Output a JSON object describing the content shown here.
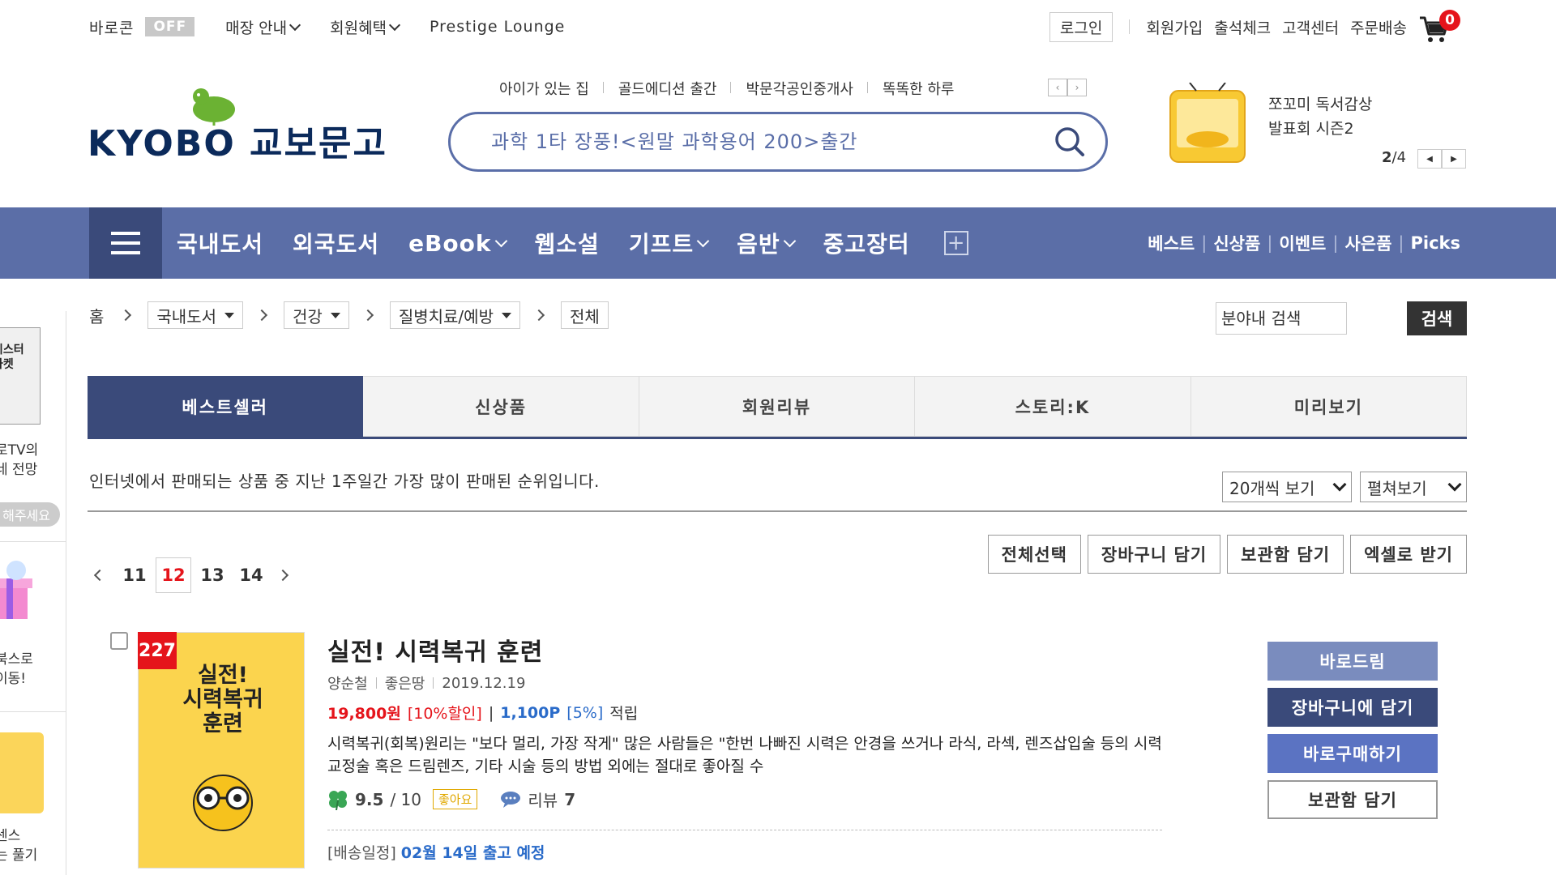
{
  "util": {
    "baro_label": "바로콘",
    "baro_state": "OFF",
    "store_info": "매장 안내",
    "member_benefit": "회원혜택",
    "prestige": "Prestige Lounge",
    "login": "로그인",
    "signup": "회원가입",
    "attendance": "출석체크",
    "support": "고객센터",
    "delivery": "주문배송",
    "cart_count": "0"
  },
  "logo": {
    "text": "KYOBO 교보문고"
  },
  "keywords": [
    "아이가 있는 집",
    "골드에디션 출간",
    "박문각공인중개사",
    "똑똑한 하루"
  ],
  "search": {
    "placeholder": "과학 1타 장풍!<원말 과학용어 200>출간"
  },
  "promo": {
    "line1": "쪼꼬미 독서감상",
    "line2": "발표회 시즌2",
    "page_current": "2",
    "page_total": "/4"
  },
  "nav": {
    "items": [
      "국내도서",
      "외국도서",
      "eBook",
      "웹소설",
      "기프트",
      "음반",
      "중고장터"
    ],
    "right": [
      "베스트",
      "신상품",
      "이벤트",
      "사은품",
      "Picks"
    ]
  },
  "side": {
    "img1_text": "미스터\n마켓",
    "text1": "로TV의\n네 전망",
    "pill": "해주세요",
    "text2": "북스로\n이동!",
    "text3": "센스\n는 풀기"
  },
  "breadcrumb": {
    "home": "홈",
    "level1": "국내도서",
    "level2": "건강",
    "level3": "질병치료/예방",
    "level4": "전체"
  },
  "cat_search": {
    "placeholder": "분야내 검색",
    "button": "검색"
  },
  "tabs": [
    "베스트셀러",
    "신상품",
    "회원리뷰",
    "스토리:K",
    "미리보기"
  ],
  "info": {
    "text": "인터넷에서 판매되는 상품 중 지난 1주일간 가장 많이 판매된 순위입니다.",
    "count_option": "20개씩 보기",
    "view_option": "펼쳐보기"
  },
  "pager": {
    "pages": [
      "11",
      "12",
      "13",
      "14"
    ],
    "current": "12"
  },
  "actions": [
    "전체선택",
    "장바구니 담기",
    "보관함 담기",
    "엑셀로 받기"
  ],
  "product": {
    "rank": "227",
    "cover_title": "실전!\n시력복귀\n훈련",
    "title": "실전! 시력복귀 훈련",
    "author": "양순철",
    "publisher": "좋은땅",
    "date": "2019.12.19",
    "price": "19,800원",
    "discount": "[10%할인]",
    "point": "1,100P",
    "point_rate": "[5%]",
    "point_label": "적립",
    "desc": "시력복귀(회복)원리는 \"보다 멀리, 가장 작게\" 많은 사람들은 \"한번 나빠진 시력은 안경을 쓰거나 라식, 라섹, 렌즈삽입술 등의 시력교정술 혹은 드림렌즈, 기타 시술 등의 방법 외에는 절대로 좋아질 수",
    "rating": "9.5",
    "rating_max": "/ 10",
    "good": "좋아요",
    "review_label": "리뷰",
    "review_count": "7",
    "ship_label": "[배송일정]",
    "ship_date": "02월 14일 출고 예정",
    "btn_baro": "바로드림",
    "btn_cart": "장바구니에 담기",
    "btn_buy": "바로구매하기",
    "btn_keep": "보관함 담기"
  },
  "colors": {
    "navbar": "#5b6ea7",
    "menu_dark": "#3a4a7a",
    "accent_red": "#e5141b",
    "link_blue": "#2a6bc9"
  }
}
